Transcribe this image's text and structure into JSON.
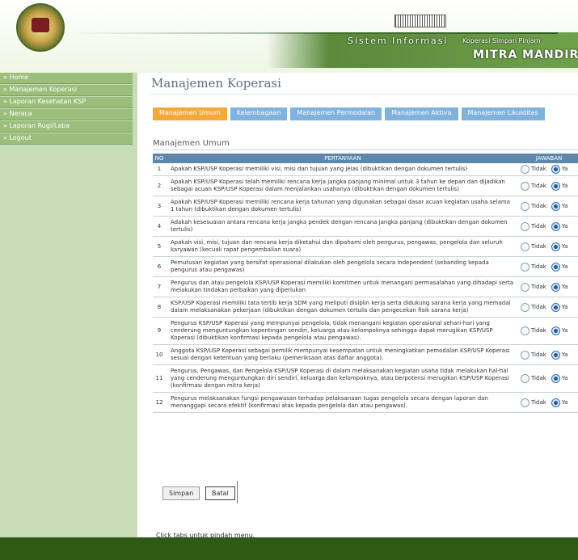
{
  "header": {
    "title": "Sistem Informasi",
    "subtitle": "Koperasi Simpan Pinjam",
    "brand": "MITRA MANDIRI"
  },
  "sidebar": {
    "items": [
      {
        "label": "» Home"
      },
      {
        "label": "» Manajemen Koperasi"
      },
      {
        "label": "» Laporan Kesehatan KSP"
      },
      {
        "label": "» Neraca"
      },
      {
        "label": "» Laporan Rugi/Laba"
      },
      {
        "label": "» Logout"
      }
    ]
  },
  "main": {
    "page_title": "Manajemen Koperasi",
    "tabs": [
      {
        "label": "Manajemen Umum",
        "active": true
      },
      {
        "label": "Kelembagaan"
      },
      {
        "label": "Manajemen Permodalan"
      },
      {
        "label": "Manajemen Aktiva"
      },
      {
        "label": "Manajemen Likuiditas"
      }
    ],
    "section_title": "Manajemen Umum",
    "table": {
      "headers": {
        "no": "NO",
        "question": "PERTANYAAN",
        "answer": "JAWABAN"
      },
      "answer_labels": {
        "no": "Tidak",
        "yes": "Ya"
      },
      "rows": [
        {
          "no": "1",
          "question": "Apakah KSP/USP Koperasi memiliki visi, misi dan tujuan yang jelas (dibuktikan dengan dokumen tertulis)",
          "selected": "yes"
        },
        {
          "no": "2",
          "question": "Apakah KSP/USP Koperasi telah memiliki rencana kerja jangka panjang minimal untuk 3 tahun ke depan dan dijadikan sebagai acuan KSP/USP Koperasi dalam menjalankan usahanya (dibuktikan dengan dokumen tertulis)",
          "selected": "yes"
        },
        {
          "no": "3",
          "question": "Apakah KSP/USP Koperasi memiliki rencana kerja tahunan yang digunakan sebagai dasar acuan kegiatan usaha selama 1 tahun (dibuktikan dengan dokumen tertulis)",
          "selected": "yes"
        },
        {
          "no": "4",
          "question": "Adakah kesesuaian antara rencana kerja jangka pendek dengan rencana jangka panjang (dibuktikan dengan dokumen tertulis)",
          "selected": "yes"
        },
        {
          "no": "5",
          "question": "Apakah visi, misi, tujuan dan rencana kerja diketahui dan dipahami oleh pengurus, pengawas, pengelola dan seluruh karyawan (kecuali rapat pengembalian suara)",
          "selected": "yes"
        },
        {
          "no": "6",
          "question": "Pemutusan kegiatan yang bersifat operasional dilakukan oleh pengelola secara independent (sebanding kepada pengurus atau pengawas)",
          "selected": "yes"
        },
        {
          "no": "7",
          "question": "Pengurus dan atau pengelola KSP/USP Koperasi memiliki komitmen untuk menangani permasalahan yang dihadapi serta melakukan tindakan perbaikan yang diperlukan",
          "selected": "yes"
        },
        {
          "no": "8",
          "question": "KSP/USP Koperasi memiliki tata tertib kerja SDM yang meliputi disiplin kerja serta didukung sarana kerja yang memadai dalam melaksanakan pekerjaan (dibuktikan dengan dokumen tertulis dan pengecekan fisik sarana kerja)",
          "selected": "yes"
        },
        {
          "no": "9",
          "question": "Pengurus KSP/USP Koperasi yang mempunyai pengelola, tidak menangani kegiatan operasional sehari-hari yang cenderung menguntungkan kepentingan sendiri, keluarga atau kelompoknya sehingga dapat merugikan KSP/USP Koperasi (dibuktikan konfirmasi kepada pengelola atau pengawas).",
          "selected": "yes"
        },
        {
          "no": "10",
          "question": "Anggota KSP/USP Koperasi sebagai pemilik mempunyai kesempatan untuk meningkatkan pemodalan KSP/USP Koperasi sesuai dengan ketentuan yang berlaku (pemeriksaan atas daftar anggota).",
          "selected": "yes"
        },
        {
          "no": "11",
          "question": "Pengurus, Pengawas, dan Pengelola KSP/USP Koperasi di dalam melaksanakan kegiatan usaha tidak melakukan hal-hal yang cenderung menguntungkan diri sendiri, keluarga dan kelompoknya, atau berpotensi merugikan KSP/USP Koperasi (konfirmasi dengan mitra kerja)",
          "selected": "yes"
        },
        {
          "no": "12",
          "question": "Pengurus melaksanakan fungsi pengawasan terhadap pelaksanaan tugas pengelola secara dengan laporan dan menanggapi secara efektif (konfirmasi atas kepada pengelola dan atau pengawas).",
          "selected": "yes"
        }
      ]
    },
    "buttons": {
      "save": "Simpan",
      "cancel": "Batal"
    },
    "footnote": "Click tabs untuk pindah menu."
  }
}
